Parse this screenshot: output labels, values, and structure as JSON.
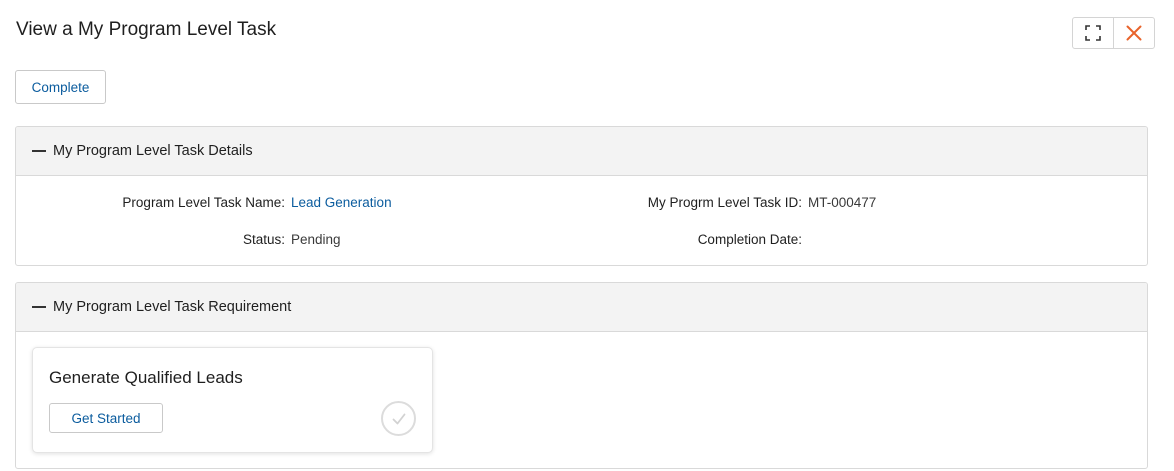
{
  "page": {
    "title": "View a My Program Level Task"
  },
  "window_controls": {
    "expand_icon": "expand-icon",
    "close_icon": "close-icon",
    "close_color": "#e8632b"
  },
  "toolbar": {
    "complete_label": "Complete"
  },
  "details": {
    "header": "My Program Level Task Details",
    "fields": {
      "task_name_label": "Program Level Task Name:",
      "task_name_value": "Lead Generation",
      "task_id_label": "My Progrm Level Task ID:",
      "task_id_value": "MT-000477",
      "status_label": "Status:",
      "status_value": "Pending",
      "completion_label": "Completion Date:",
      "completion_value": ""
    }
  },
  "requirement": {
    "header": "My Program Level Task Requirement",
    "card": {
      "title": "Generate Qualified Leads",
      "button_label": "Get Started",
      "status_icon": "check-circle-icon"
    }
  },
  "colors": {
    "link": "#0b5c9e",
    "header_bg": "#f3f3f3",
    "border": "#d9d9d9"
  }
}
